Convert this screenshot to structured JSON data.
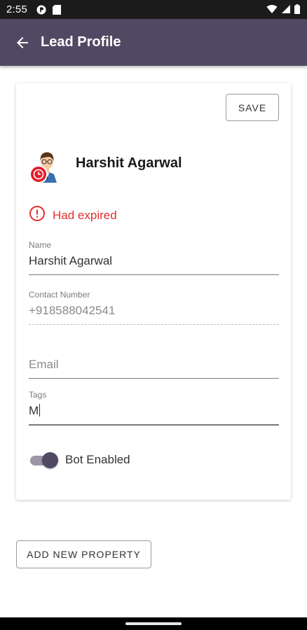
{
  "status_bar": {
    "time": "2:55",
    "left_icons": [
      "privacy-icon",
      "sim-card-icon"
    ],
    "right_icons": [
      "wifi-icon",
      "signal-icon",
      "battery-icon"
    ]
  },
  "app_bar": {
    "title": "Lead Profile",
    "back_icon": "arrow-back-icon",
    "color": "#514963"
  },
  "card": {
    "save_label": "SAVE",
    "lead_name": "Harshit Agarwal",
    "avatar_icon": "person-clock-icon",
    "status": {
      "icon": "alert-circle-icon",
      "text": "Had expired",
      "color": "#e0302f"
    },
    "fields": {
      "name": {
        "label": "Name",
        "value": "Harshit Agarwal"
      },
      "contact": {
        "label": "Contact Number",
        "value": "+918588042541"
      },
      "email": {
        "placeholder": "Email",
        "value": ""
      },
      "tags": {
        "label": "Tags",
        "value": "M"
      }
    },
    "bot_toggle": {
      "label": "Bot Enabled",
      "on": true
    }
  },
  "add_property_label": "ADD NEW PROPERTY"
}
